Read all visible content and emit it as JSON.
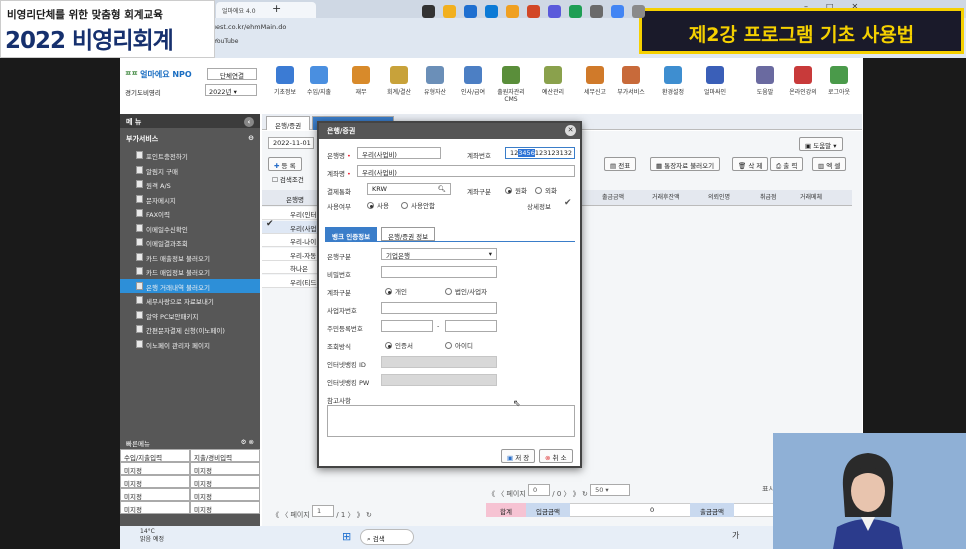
{
  "banner": {
    "subtitle": "비영리단체를 위한 맞춤형 회계교육",
    "title": "2022 비영리회계",
    "lecture": "제2강 프로그램 기초 사용법"
  },
  "browser": {
    "tab_label": "얼마에요 4.0",
    "new_tab": "+",
    "url": "iquest.co.kr/ehmMain.do",
    "bookmark": "YouTube"
  },
  "app": {
    "brand": "얼마에요 NPO",
    "org_type": "단체연결",
    "region": "경기도비영리",
    "year": "2022년",
    "toolbar": [
      "기초정보",
      "수입/지출",
      "재무",
      "회계/결산",
      "유형자산",
      "인사/급여",
      "출원자관리 CMS",
      "예산관리",
      "세무신고",
      "부가서비스",
      "환경설정",
      "얼마싸인",
      "도움말",
      "온라인강의",
      "로그아웃"
    ]
  },
  "sidebar": {
    "header": "메 뉴",
    "section": "부가서비스",
    "items": [
      "포인트충전하기",
      "알림지 구매",
      "원격 A/S",
      "문자메시지",
      "FAX이력",
      "이메일수신확인",
      "이메일결과조회",
      "카드 매출정보 불러오기",
      "카드 매입정보 불러오기",
      "은행 거래내역 불러오기",
      "세무사랑으로 자료보내기",
      "알약 PC보안패키지",
      "간편문자결제 신청(이노페이)",
      "이노페이 관리자 페이지"
    ],
    "active_index": 9
  },
  "favorites": {
    "header": "빠른메뉴",
    "rows": [
      [
        "수입/지출입력",
        "지출/경비입력"
      ],
      [
        "미지정",
        "미지정"
      ],
      [
        "미지정",
        "미지정"
      ],
      [
        "미지정",
        "미지정"
      ],
      [
        "미지정",
        "미지정"
      ]
    ]
  },
  "main": {
    "tabs": [
      "은행/증권",
      "은행 거래내역 불러오기"
    ],
    "date": "2022-11-01",
    "add": "등 록",
    "search_cond": "검색조건",
    "help": "도움말",
    "buttons": [
      "전표",
      "통장자료 불러오기",
      "삭 제",
      "출 력",
      "엑 셀"
    ],
    "list_header": "은행명",
    "list": [
      "우리(인터",
      "우리(사업",
      "우리-나이",
      "우리-자동",
      "하나은",
      "우리(티드"
    ],
    "grid_headers": [
      "출금금액",
      "거래후잔액",
      "의뢰인명",
      "취급점",
      "거래메체"
    ],
    "pager_left": {
      "page_label": "페이지",
      "page": "1",
      "total": "/ 1"
    },
    "pager_right": {
      "page_label": "페이지",
      "page": "0",
      "total": "/ 0",
      "per_page": "50",
      "display": "표시"
    },
    "footer": [
      "합계",
      "입금금액",
      "0",
      "출금금액"
    ]
  },
  "modal": {
    "title": "은행/증권",
    "bank_label": "은행명",
    "bank_value": "우리(사업비)",
    "acct_label": "계좌번호",
    "acct_pre": "12",
    "acct_hl": "3456",
    "acct_post": "123123132",
    "acct_name_label": "계좌명",
    "acct_name_value": "우리(사업비)",
    "currency_label": "결제통화",
    "currency_value": "KRW",
    "acct_class_label": "계좌구분",
    "won": "원화",
    "foreign": "외화",
    "use_label": "사용여부",
    "use_yes": "사용",
    "use_no": "사용안함",
    "detail_label": "상세정보",
    "subtabs": [
      "뱅크 인증정보",
      "은행/증권 정보"
    ],
    "bank_type_label": "은행구분",
    "bank_type_value": "기업은행",
    "password_label": "비밀번호",
    "acct_type_label": "계좌구분",
    "personal": "개인",
    "corporate": "법인/사업자",
    "biz_no_label": "사업자번호",
    "resident_no_label": "주민등록번호",
    "inquiry_label": "조회방식",
    "cert": "인증서",
    "id": "아이디",
    "ib_id_label": "인터넷뱅킹 ID",
    "ib_pw_label": "인터넷뱅킹 PW",
    "note_label": "참고사항",
    "save": "저 장",
    "cancel": "취 소"
  },
  "taskbar": {
    "weather_temp": "14°C",
    "weather_desc": "맑음 예정",
    "search": "검색",
    "lang": "가"
  }
}
